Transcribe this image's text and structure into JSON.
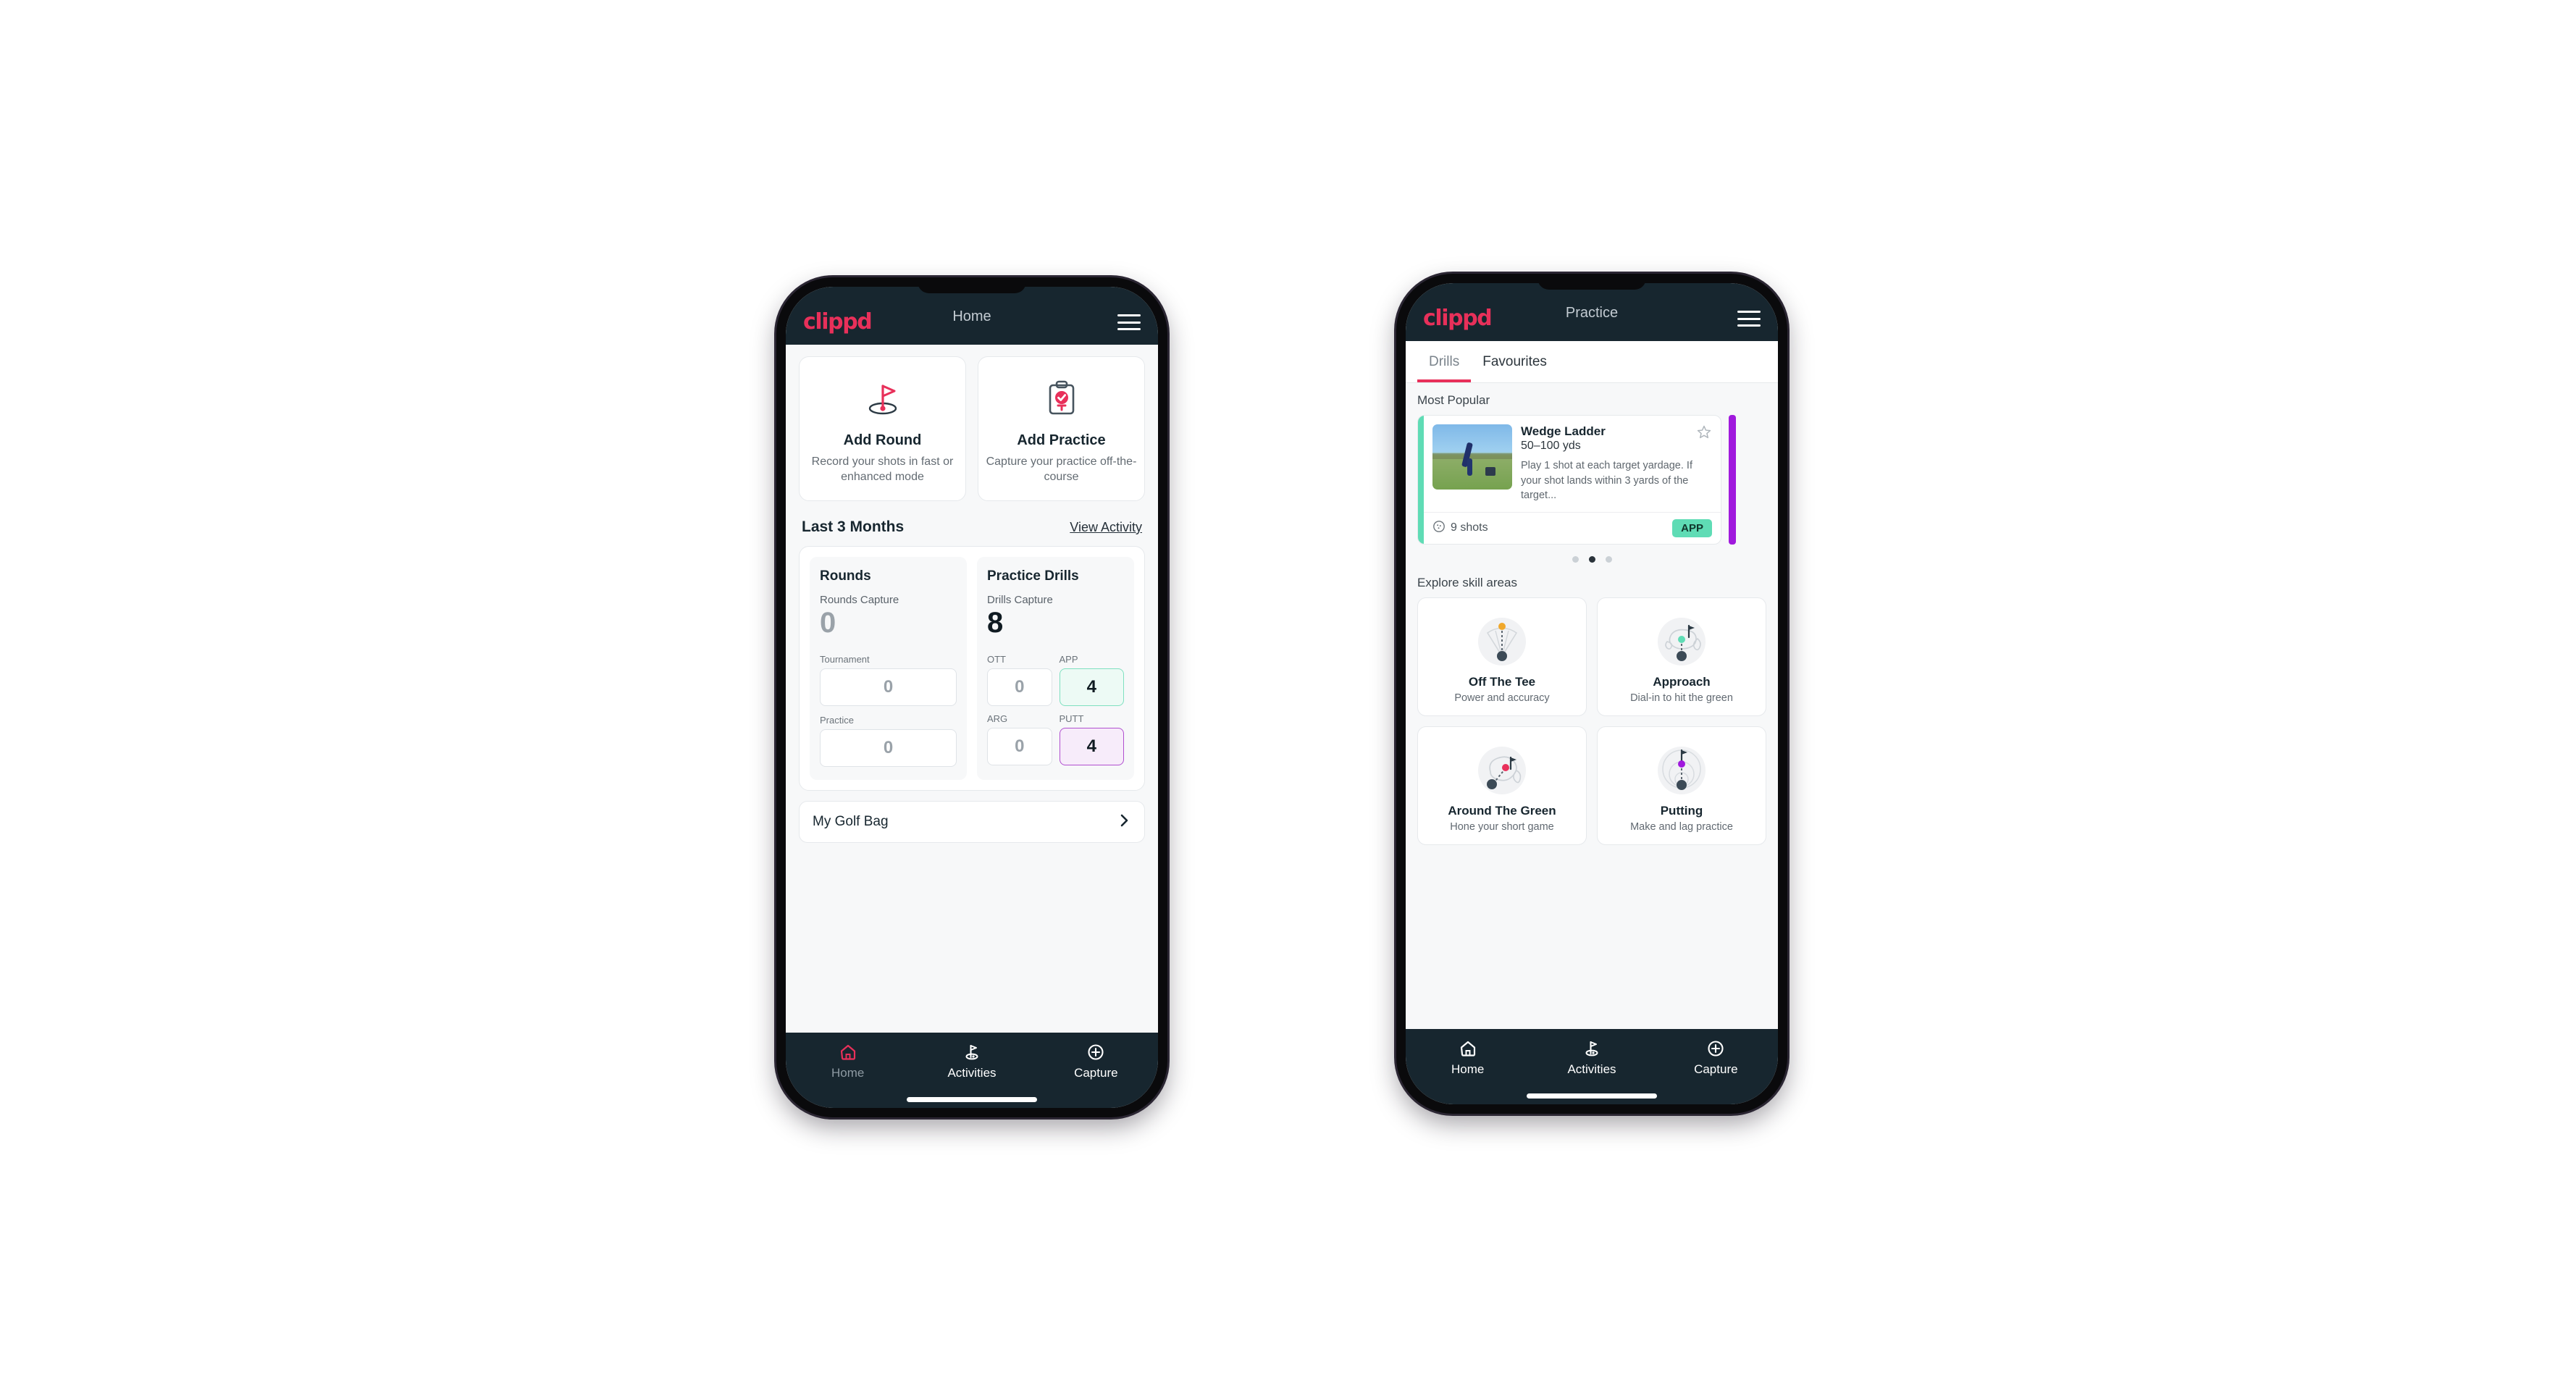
{
  "brand": {
    "logo_text": "clippd",
    "accent": "#e8305a",
    "dark": "#17262f"
  },
  "phone_home": {
    "appbar": {
      "title": "Home",
      "menu_icon": "hamburger-menu-icon"
    },
    "quick_actions": [
      {
        "icon": "golf-flag-icon",
        "title": "Add Round",
        "subtitle": "Record your shots in fast or enhanced mode"
      },
      {
        "icon": "clipboard-check-icon",
        "title": "Add Practice",
        "subtitle": "Capture your practice off-the-course"
      }
    ],
    "section": {
      "title": "Last 3 Months",
      "link": "View Activity"
    },
    "rounds": {
      "heading": "Rounds",
      "capture_label": "Rounds Capture",
      "capture_value": "0",
      "fields": [
        {
          "label": "Tournament",
          "value": "0",
          "state": "empty"
        },
        {
          "label": "Practice",
          "value": "0",
          "state": "empty"
        }
      ]
    },
    "drills": {
      "heading": "Practice Drills",
      "capture_label": "Drills Capture",
      "capture_value": "8",
      "fields": [
        {
          "label": "OTT",
          "value": "0",
          "state": "empty"
        },
        {
          "label": "APP",
          "value": "4",
          "state": "app"
        },
        {
          "label": "ARG",
          "value": "0",
          "state": "empty"
        },
        {
          "label": "PUTT",
          "value": "4",
          "state": "putt"
        }
      ]
    },
    "bag": {
      "label": "My Golf Bag",
      "icon": "chevron-right-icon"
    },
    "bottom_nav": [
      {
        "icon": "home-icon",
        "label": "Home"
      },
      {
        "icon": "golf-flag-icon",
        "label": "Activities"
      },
      {
        "icon": "plus-circle-icon",
        "label": "Capture"
      }
    ]
  },
  "phone_practice": {
    "appbar": {
      "title": "Practice",
      "menu_icon": "hamburger-menu-icon"
    },
    "tabs": [
      {
        "label": "Drills",
        "active": true
      },
      {
        "label": "Favourites",
        "active": false
      }
    ],
    "most_popular_label": "Most Popular",
    "drill_card": {
      "title": "Wedge Ladder",
      "yardage": "50–100 yds",
      "description": "Play 1 shot at each target yardage. If your shot lands within 3 yards of the target...",
      "shots": "9 shots",
      "shots_icon": "shots-circle-icon",
      "badge": "APP",
      "badge_color": "#5fdcb5",
      "accent_color": "#5fdcb5",
      "next_accent_color": "#a019dd",
      "favourite_icon": "star-outline-icon"
    },
    "carousel_dots": {
      "count": 3,
      "active_index": 1
    },
    "skill_section_label": "Explore skill areas",
    "skills": [
      {
        "icon": "tee-fan-icon",
        "name": "Off The Tee",
        "subtitle": "Power and accuracy",
        "dot_color": "#f0a82c"
      },
      {
        "icon": "green-approach-icon",
        "name": "Approach",
        "subtitle": "Dial-in to hit the green",
        "dot_color": "#5fdcb5"
      },
      {
        "icon": "chip-green-icon",
        "name": "Around The Green",
        "subtitle": "Hone your short game",
        "dot_color": "#e8305a"
      },
      {
        "icon": "putting-rings-icon",
        "name": "Putting",
        "subtitle": "Make and lag practice",
        "dot_color": "#a019dd"
      }
    ],
    "bottom_nav": [
      {
        "icon": "home-icon",
        "label": "Home"
      },
      {
        "icon": "golf-flag-icon",
        "label": "Activities"
      },
      {
        "icon": "plus-circle-icon",
        "label": "Capture"
      }
    ]
  }
}
